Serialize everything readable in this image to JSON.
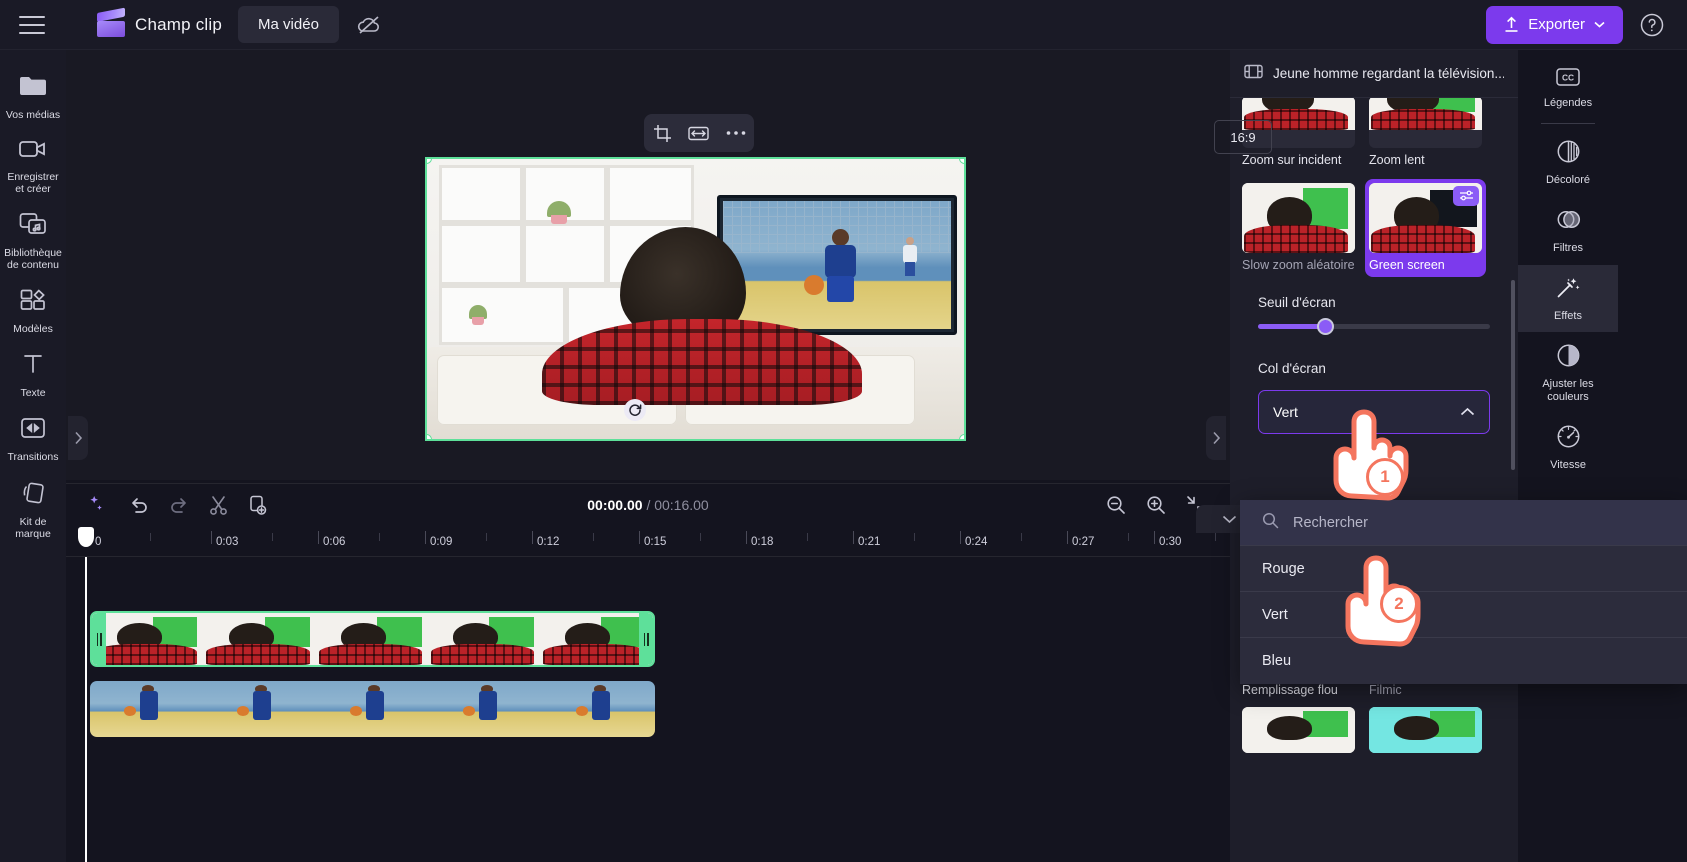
{
  "app": {
    "brand": "Champ clip",
    "project_tab": "Ma vidéo",
    "export_label": "Exporter"
  },
  "left_rail": {
    "items": [
      {
        "icon": "folder-icon",
        "label": "Vos médias"
      },
      {
        "icon": "camera-icon",
        "label": "Enregistrer\net créer",
        "line1": "Enregistrer",
        "line2": "et créer"
      },
      {
        "icon": "content-library-icon",
        "label": "Bibliothèque",
        "line1": "Bibliothèque",
        "line2": "de contenu"
      },
      {
        "icon": "templates-icon",
        "label": "Modèles"
      },
      {
        "icon": "text-icon",
        "label": "Texte"
      },
      {
        "icon": "transitions-icon",
        "label": "Transitions"
      },
      {
        "icon": "brand-kit-icon",
        "label": "Kit de marque"
      }
    ]
  },
  "stage": {
    "aspect_ratio": "16:9",
    "toolbar": [
      "crop-icon",
      "fit-icon",
      "more-icon"
    ],
    "controls": [
      "captions-off-icon",
      "skip-back-icon",
      "rewind-5-icon",
      "play-icon",
      "forward-5-icon",
      "skip-forward-icon",
      "fullscreen-icon"
    ]
  },
  "timeline": {
    "current_time": "00:00.00",
    "separator": "/",
    "total_time": "00:16.00",
    "tools": [
      "magic-wand-icon",
      "undo-icon",
      "redo-icon",
      "split-icon",
      "duplicate-icon"
    ],
    "zoom_tools": [
      "zoom-out-icon",
      "zoom-in-icon",
      "fit-timeline-icon"
    ],
    "ruler_labels": [
      "0",
      "0:03",
      "0:06",
      "0:09",
      "0:12",
      "0:15",
      "0:18",
      "0:21",
      "0:24",
      "0:27",
      "0:30"
    ]
  },
  "effects_panel": {
    "header_title": "Jeune homme regardant la télévision...",
    "items_row1": [
      {
        "label": "Zoom sur incident",
        "selected": false
      },
      {
        "label": "Zoom lent",
        "selected": false
      }
    ],
    "items_row2": [
      {
        "label": "Slow zoom aléatoire",
        "selected": false,
        "dim": true
      },
      {
        "label": "Green screen",
        "selected": true
      }
    ],
    "items_row3": [
      {
        "label": "Remplissage flou",
        "selected": false
      },
      {
        "label": "Filmic",
        "selected": false,
        "dim": true
      }
    ],
    "threshold_label": "Seuil d'écran",
    "threshold_value": 29,
    "color_label": "Col d'écran",
    "color_value": "Vert"
  },
  "dropdown": {
    "search_placeholder": "Rechercher",
    "options": [
      "Rouge",
      "Vert",
      "Bleu"
    ]
  },
  "right_rail": {
    "items": [
      {
        "icon": "captions-icon",
        "label": "Légendes",
        "active": false
      },
      {
        "icon": "fade-icon",
        "label": "Décoloré",
        "active": false
      },
      {
        "icon": "filters-icon",
        "label": "Filtres",
        "active": false
      },
      {
        "icon": "effects-icon",
        "label": "Effets",
        "active": true
      },
      {
        "icon": "adjust-colors-icon",
        "line1": "Ajuster les",
        "line2": "couleurs",
        "label": "Ajuster les couleurs",
        "active": false
      },
      {
        "icon": "speed-icon",
        "label": "Vitesse",
        "active": false
      }
    ]
  },
  "annotations": {
    "step1": "1",
    "step2": "2"
  },
  "colors": {
    "accent": "#7c3aed",
    "selection": "#5ee09a",
    "badge": "#f4755e",
    "panel_bg": "#1e1e2a"
  }
}
